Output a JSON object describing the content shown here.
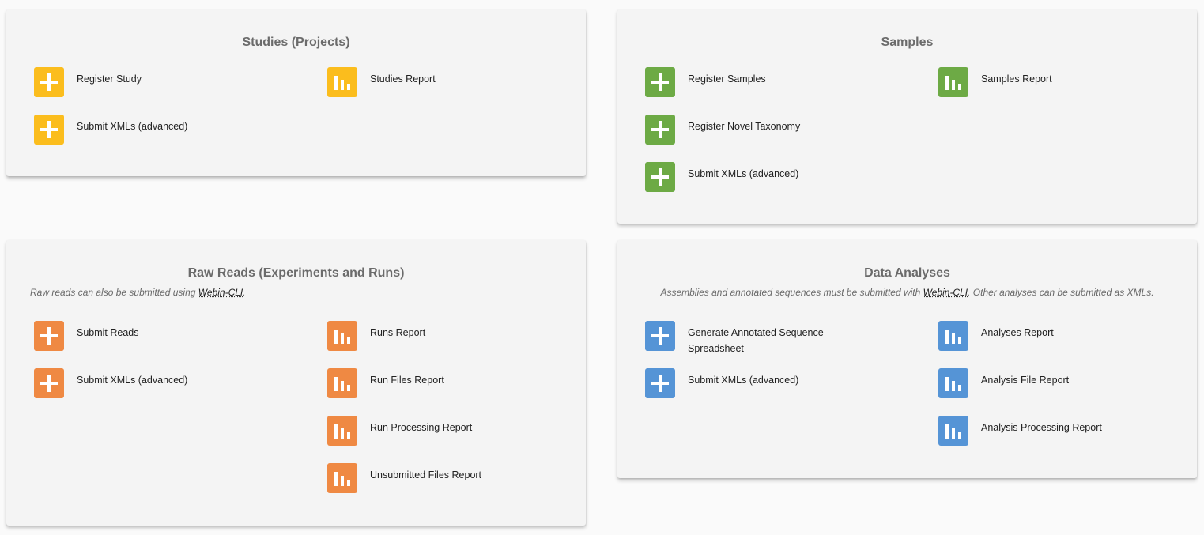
{
  "colors": {
    "studies": "#fbbd1d",
    "samples": "#6daa45",
    "reads": "#ef8943",
    "analyses": "#5594d6",
    "card_background": "#f4f4f4",
    "page_background": "#fafafa"
  },
  "studies": {
    "title": "Studies (Projects)",
    "actions": [
      {
        "label": "Register Study",
        "icon": "plus-icon"
      },
      {
        "label": "Submit XMLs (advanced)",
        "icon": "plus-icon"
      }
    ],
    "reports": [
      {
        "label": "Studies Report",
        "icon": "bar-chart-icon"
      }
    ]
  },
  "samples": {
    "title": "Samples",
    "actions": [
      {
        "label": "Register Samples",
        "icon": "plus-icon"
      },
      {
        "label": "Register Novel Taxonomy",
        "icon": "plus-icon"
      },
      {
        "label": "Submit XMLs (advanced)",
        "icon": "plus-icon"
      }
    ],
    "reports": [
      {
        "label": "Samples Report",
        "icon": "bar-chart-icon"
      }
    ]
  },
  "reads": {
    "title": "Raw Reads (Experiments and Runs)",
    "note_prefix": "Raw reads can also be submitted using ",
    "note_link": "Webin-CLI",
    "note_suffix": ".",
    "actions": [
      {
        "label": "Submit Reads",
        "icon": "plus-icon"
      },
      {
        "label": "Submit XMLs (advanced)",
        "icon": "plus-icon"
      }
    ],
    "reports": [
      {
        "label": "Runs Report",
        "icon": "bar-chart-icon"
      },
      {
        "label": "Run Files Report",
        "icon": "bar-chart-icon"
      },
      {
        "label": "Run Processing Report",
        "icon": "bar-chart-icon"
      },
      {
        "label": "Unsubmitted Files Report",
        "icon": "bar-chart-icon"
      }
    ]
  },
  "analyses": {
    "title": "Data Analyses",
    "note_prefix": "Assemblies and annotated sequences must be submitted with ",
    "note_link": "Webin-CLI",
    "note_suffix": ". Other analyses can be submitted as XMLs.",
    "actions": [
      {
        "label": "Generate Annotated Sequence Spreadsheet",
        "icon": "plus-icon"
      },
      {
        "label": "Submit XMLs (advanced)",
        "icon": "plus-icon"
      }
    ],
    "reports": [
      {
        "label": "Analyses Report",
        "icon": "bar-chart-icon"
      },
      {
        "label": "Analysis File Report",
        "icon": "bar-chart-icon"
      },
      {
        "label": "Analysis Processing Report",
        "icon": "bar-chart-icon"
      }
    ]
  }
}
